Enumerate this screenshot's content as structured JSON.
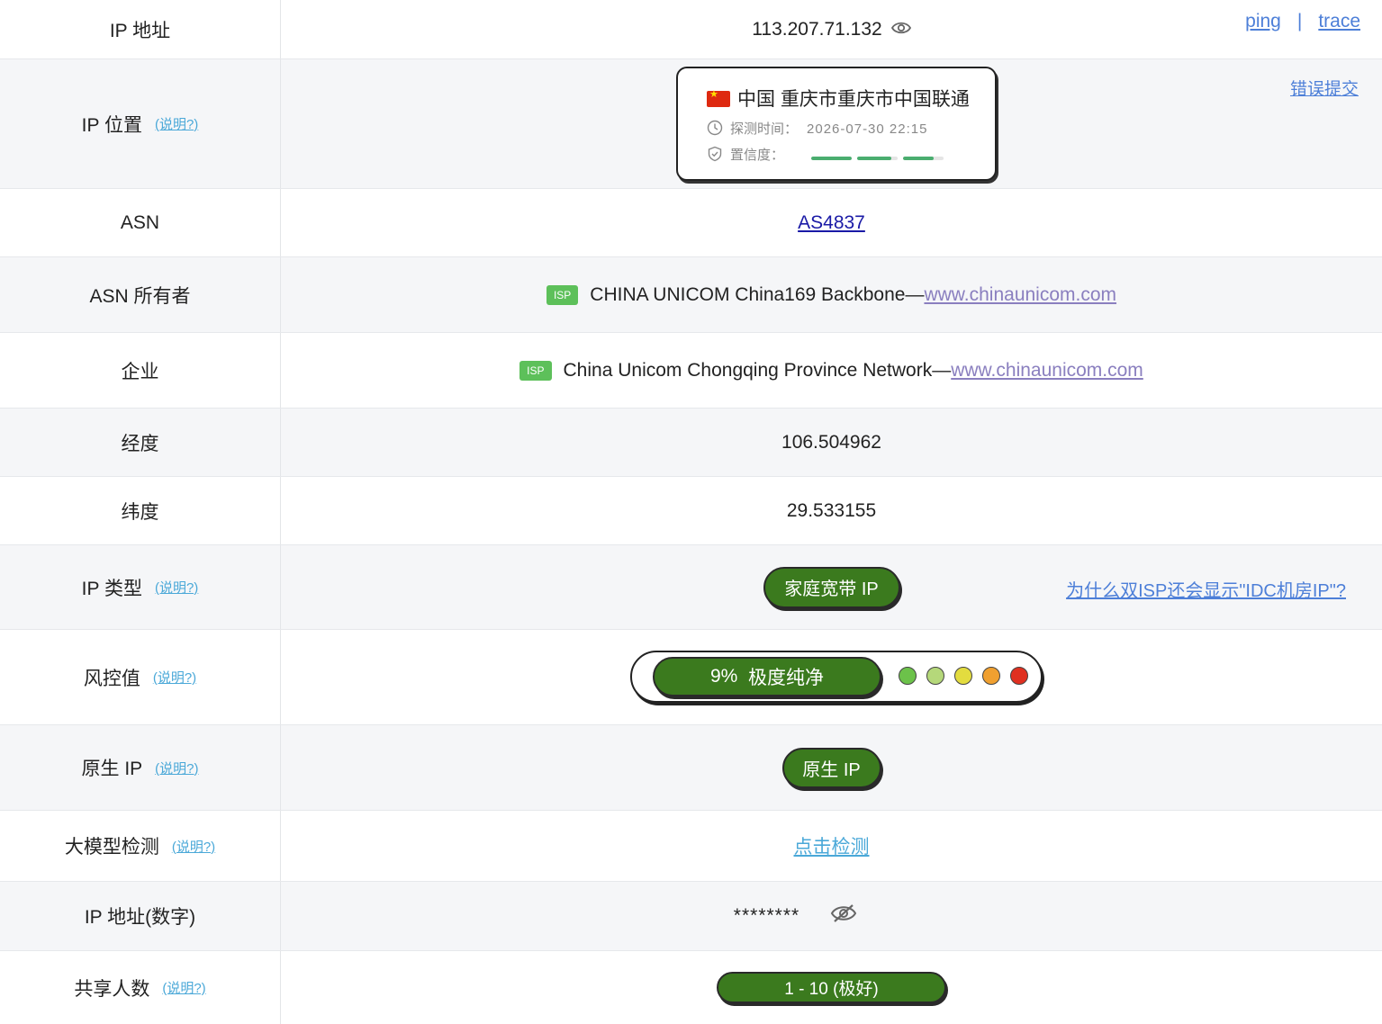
{
  "ip_row": {
    "label": "IP 地址",
    "value": "113.207.71.132",
    "ping": "ping",
    "sep": "|",
    "trace": "trace"
  },
  "location_row": {
    "label": "IP 位置",
    "help": "(说明?)",
    "location_text": "中国 重庆市重庆市中国联通",
    "detect_label": "探测时间：",
    "detect_time": "2026-07-30 22:15",
    "confidence_label": "置信度：",
    "confidence_levels": [
      1.0,
      0.85,
      0.75
    ],
    "error_link": "错误提交"
  },
  "asn_row": {
    "label": "ASN",
    "value": "AS4837"
  },
  "asn_owner_row": {
    "label": "ASN 所有者",
    "badge": "ISP",
    "name": "CHINA UNICOM China169 Backbone—",
    "link": "www.chinaunicom.com"
  },
  "company_row": {
    "label": "企业",
    "badge": "ISP",
    "name": "China Unicom Chongqing Province Network—",
    "link": "www.chinaunicom.com"
  },
  "longitude_row": {
    "label": "经度",
    "value": "106.504962"
  },
  "latitude_row": {
    "label": "纬度",
    "value": "29.533155"
  },
  "ip_type_row": {
    "label": "IP 类型",
    "help": "(说明?)",
    "value": "家庭宽带 IP",
    "side_link": "为什么双ISP还会显示\"IDC机房IP\"?"
  },
  "risk_row": {
    "label": "风控值",
    "help": "(说明?)",
    "percent": "9%",
    "level": "极度纯净",
    "dot_colors": [
      "#6cc24a",
      "#b5d87a",
      "#e3dc3f",
      "#f0a030",
      "#e03020"
    ]
  },
  "native_row": {
    "label": "原生 IP",
    "help": "(说明?)",
    "value": "原生 IP"
  },
  "llm_row": {
    "label": "大模型检测",
    "help": "(说明?)",
    "value": "点击检测"
  },
  "ip_numeric_row": {
    "label": "IP 地址(数字)",
    "value": "********"
  },
  "share_row": {
    "label": "共享人数",
    "help": "(说明?)",
    "value": "1 - 10 (极好)"
  },
  "colors": {
    "accent_green": "#3b7a1e",
    "link_blue": "#4d7fd8",
    "help_blue": "#4aa8d8",
    "isp_badge": "#5dc05a",
    "confidence_green": "#4aad6f"
  },
  "icons": [
    "eye-icon",
    "cn-flag-icon",
    "clock-icon",
    "shield-check-icon",
    "eye-slash-icon"
  ]
}
